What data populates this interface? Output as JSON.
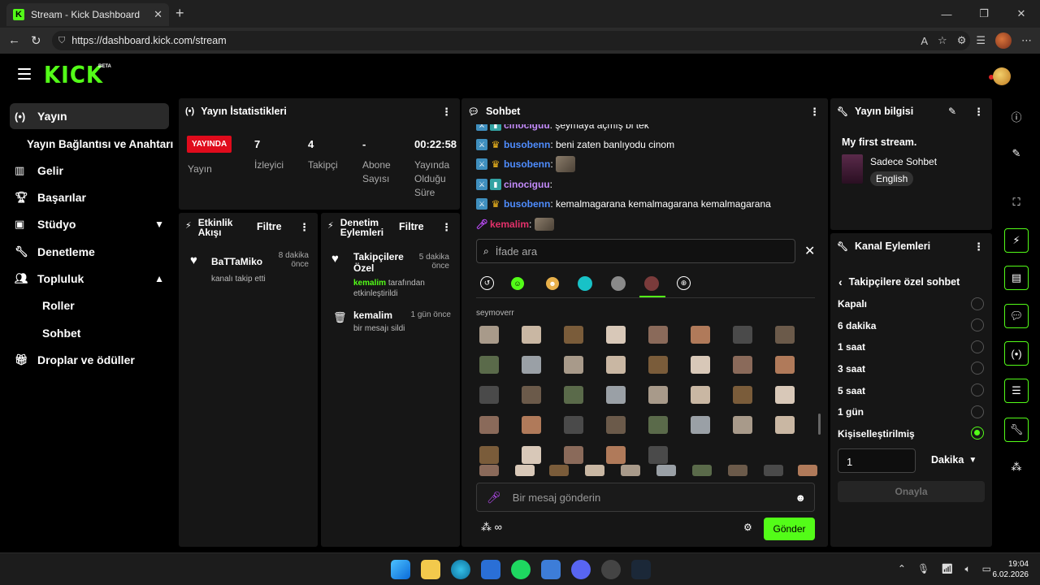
{
  "browser": {
    "tab_title": "Stream - Kick Dashboard",
    "url": "https://dashboard.kick.com/stream"
  },
  "header": {
    "logo": "KICK",
    "logo_badge": "BETA"
  },
  "sidebar": {
    "items": [
      {
        "label": "Yayın",
        "icon": "broadcast-icon"
      },
      {
        "label": "Yayın Bağlantısı ve Anahtarı",
        "icon": ""
      },
      {
        "label": "Gelir",
        "icon": "revenue-icon"
      },
      {
        "label": "Başarılar",
        "icon": "trophy-icon"
      },
      {
        "label": "Stüdyo",
        "icon": "studio-icon"
      },
      {
        "label": "Denetleme",
        "icon": "wrench-icon"
      },
      {
        "label": "Topluluk",
        "icon": "people-icon"
      },
      {
        "label": "Roller",
        "icon": ""
      },
      {
        "label": "Sohbet",
        "icon": ""
      },
      {
        "label": "Droplar ve ödüller",
        "icon": "gift-icon"
      }
    ]
  },
  "stats": {
    "title": "Yayın İstatistikleri",
    "live_badge": "YAYINDA",
    "live_label": "Yayın",
    "items": [
      {
        "value": "7",
        "label": "İzleyici"
      },
      {
        "value": "4",
        "label": "Takipçi"
      },
      {
        "value": "-",
        "label": "Abone Sayısı"
      },
      {
        "value": "00:22:58",
        "label": "Yayında Olduğu Süre"
      }
    ]
  },
  "activity": {
    "title": "Etkinlik Akışı",
    "filter": "Filtre",
    "entries": [
      {
        "name": "BaTTaMiko",
        "desc": "kanalı takip etti",
        "time": "8 dakika önce"
      }
    ]
  },
  "mod_actions": {
    "title": "Denetim Eylemleri",
    "filter": "Filtre",
    "entries": [
      {
        "name": "Takipçilere Özel",
        "actor": "kemalim",
        "desc": "tarafından etkinleştirildi",
        "time": "5 dakika önce"
      },
      {
        "name": "kemalim",
        "desc": "bir mesajı sildi",
        "time": "1 gün önce"
      }
    ]
  },
  "chat": {
    "title": "Sohbet",
    "messages": [
      {
        "user": "cinociguu",
        "color": "#c38bfa",
        "text": "şeymaya açmış bi tek",
        "badges": [
          "mod",
          "vip"
        ]
      },
      {
        "user": "busobenn",
        "color": "#4f8dff",
        "text": "beni zaten banlıyodu cinom",
        "badges": [
          "mod",
          "crown"
        ]
      },
      {
        "user": "busobenn",
        "color": "#4f8dff",
        "text": "",
        "badges": [
          "mod",
          "crown"
        ],
        "emote": true
      },
      {
        "user": "cinociguu",
        "color": "#c38bfa",
        "text": "",
        "badges": [
          "mod",
          "vip"
        ]
      },
      {
        "user": "busobenn",
        "color": "#4f8dff",
        "text": "kemalmagarana kemalmagarana kemalmagarana",
        "badges": [
          "mod",
          "crown"
        ]
      },
      {
        "user": "kemalim",
        "color": "#e3316a",
        "text": "",
        "badges": [
          "mic"
        ],
        "emote": true
      }
    ],
    "emote_search_placeholder": "İfade ara",
    "emote_section": "seymoverr",
    "input_placeholder": "Bir mesaj gönderin",
    "send_label": "Gönder"
  },
  "stream_info": {
    "title": "Yayın bilgisi",
    "stream_title": "My first stream.",
    "category": "Sadece Sohbet",
    "language": "English"
  },
  "channel_actions": {
    "title": "Kanal Eylemleri",
    "subtitle": "Takipçilere özel sohbet",
    "options": [
      {
        "label": "Kapalı",
        "selected": false
      },
      {
        "label": "6 dakika",
        "selected": false
      },
      {
        "label": "1 saat",
        "selected": false
      },
      {
        "label": "3 saat",
        "selected": false
      },
      {
        "label": "5 saat",
        "selected": false
      },
      {
        "label": "1 gün",
        "selected": false
      },
      {
        "label": "Kişiselleştirilmiş",
        "selected": true
      }
    ],
    "custom_value": "1",
    "unit": "Dakika",
    "confirm": "Onayla"
  },
  "taskbar": {
    "time": "19:04",
    "date": "6.02.2026"
  },
  "colors": {
    "accent": "#53fc18",
    "live": "#e00b1c",
    "panel": "#161616"
  }
}
